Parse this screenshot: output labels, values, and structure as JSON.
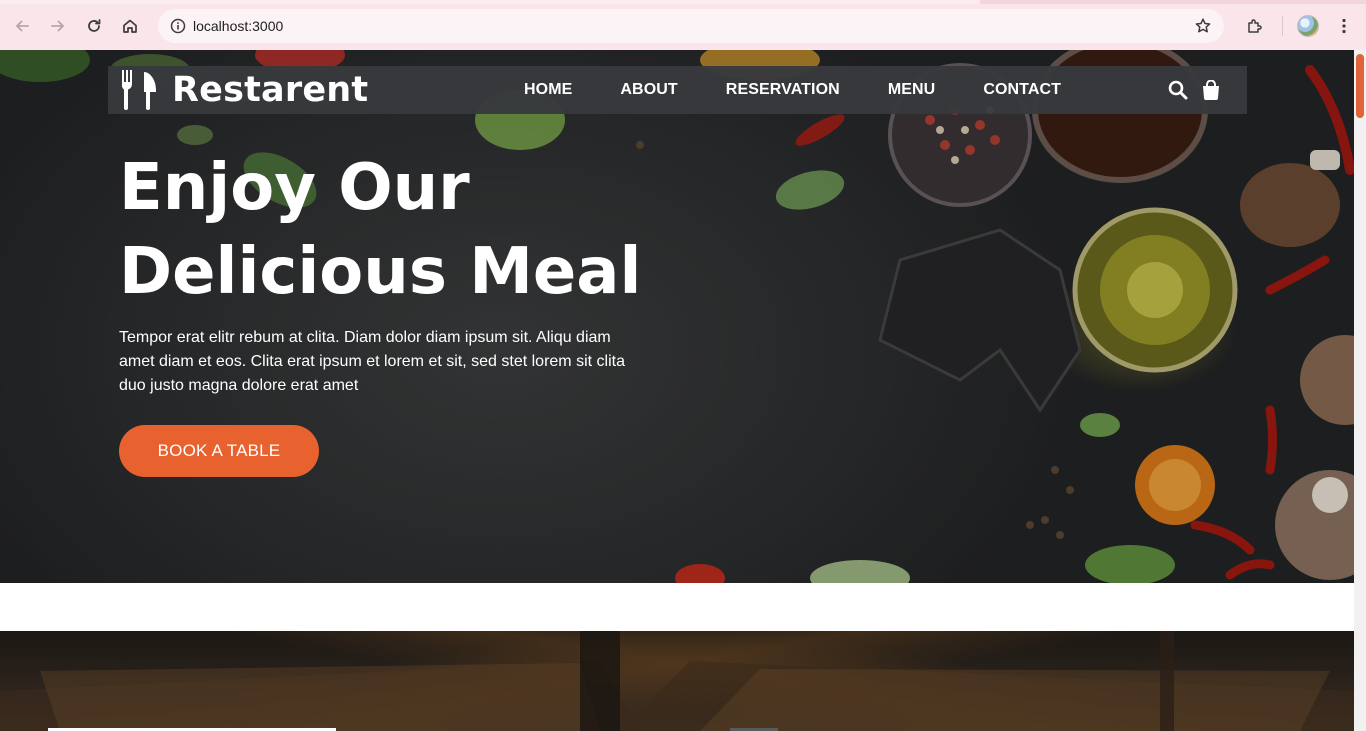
{
  "browser": {
    "url": "localhost:3000",
    "icons": [
      "back-icon",
      "forward-icon",
      "reload-icon",
      "home-icon",
      "site-info-icon",
      "bookmark-star-icon",
      "extensions-icon",
      "profile-avatar",
      "menu-kebab-icon"
    ]
  },
  "navbar": {
    "brand": "Restarent",
    "brand_icon": "utensils-icon",
    "links": [
      "HOME",
      "ABOUT",
      "RESERVATION",
      "MENU",
      "CONTACT"
    ],
    "icons": [
      "search-icon",
      "shopping-bag-icon"
    ]
  },
  "hero": {
    "title_line1": "Enjoy Our",
    "title_line2": "Delicious Meal",
    "description": "Tempor erat elitr rebum at clita. Diam dolor diam ipsum sit. Aliqu diam amet diam et eos. Clita erat ipsum et lorem et sit, sed stet lorem sit clita duo justo magna dolore erat amet",
    "cta_label": "BOOK A TABLE"
  },
  "colors": {
    "accent": "#e8622f",
    "navbar_bg": "#37393d",
    "chrome_bg": "#f9e5ea",
    "hero_bg": "#2e3032"
  }
}
